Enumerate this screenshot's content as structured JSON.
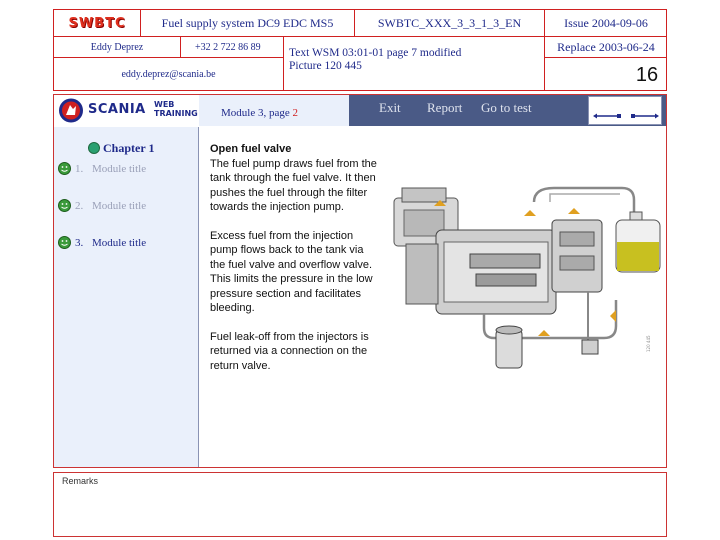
{
  "header": {
    "logo": "SWBTC",
    "title": "Fuel supply system DC9 EDC MS5",
    "doc_id": "SWBTC_XXX_3_3_1_3_EN",
    "issue": "Issue 2004-09-06",
    "author": "Eddy Deprez",
    "phone": "+32 2 722 86 89",
    "email": "eddy.deprez@scania.be",
    "reference": "Text WSM 03:01-01 page 7 modified",
    "picture": "Picture 120 445",
    "replace": "Replace 2003-06-24",
    "page_number": "16"
  },
  "navbar": {
    "brand": "SCANIA",
    "brand_sub_1": "WEB",
    "brand_sub_2": "TRAINING",
    "module_prefix": "Module 3, page ",
    "module_page": "2",
    "links": [
      "Exit",
      "Report",
      "Go to test"
    ]
  },
  "sidebar": {
    "chapter": "Chapter 1",
    "items": [
      {
        "num": "1.",
        "label": "Module title",
        "active": false
      },
      {
        "num": "2.",
        "label": "Module title",
        "active": false
      },
      {
        "num": "3.",
        "label": "Module title",
        "active": true
      }
    ]
  },
  "content": {
    "title": "Open fuel valve",
    "paragraphs": [
      "The fuel pump draws fuel from the tank through the fuel valve. It then pushes the fuel through the filter towards the injection pump.",
      "Excess fuel from the injection pump flows back to the tank via the fuel valve and overflow valve. This limits the pressure in the low pressure section and facilitates bleeding.",
      "Fuel leak-off from the injectors is returned via a connection on the return valve."
    ],
    "figure_code": "120 445"
  },
  "remarks": {
    "label": "Remarks"
  },
  "colors": {
    "frame_red": "#cc3333",
    "navbar_blue": "#4a5a86",
    "sidebar_bg": "#eaf0fb",
    "fuel_yellow": "#c8c020",
    "smiley_green": "#3a9a3a",
    "chapter_dot": "#2aa070"
  }
}
